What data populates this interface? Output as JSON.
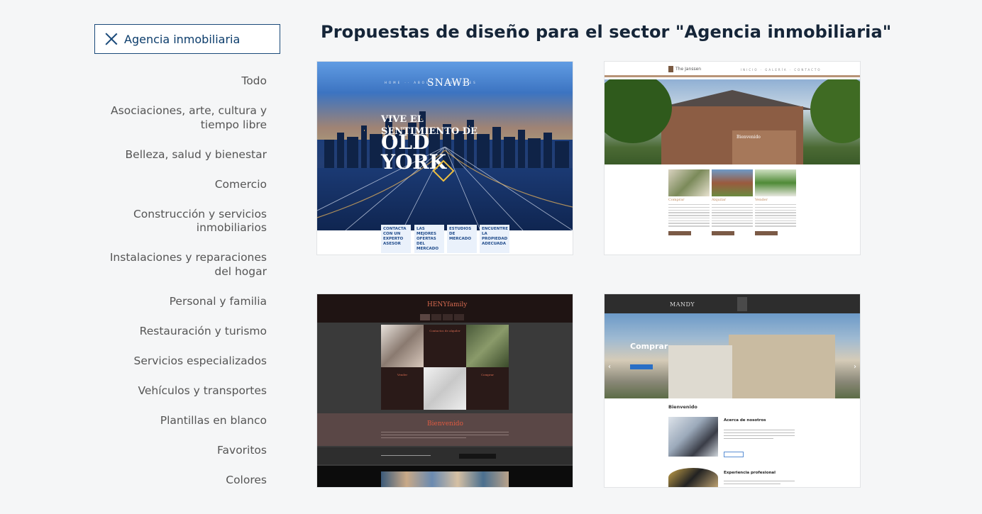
{
  "filter": {
    "active_label": "Agencia inmobiliaria"
  },
  "heading": "Propuestas de diseño para el sector \"Agencia inmobiliaria\"",
  "categories": [
    "Todo",
    "Asociaciones, arte, cultura y tiempo libre",
    "Belleza, salud y bienestar",
    "Comercio",
    "Construcción y servicios inmobiliarios",
    "Instalaciones y reparaciones del hogar",
    "Personal y familia",
    "Restauración y turismo",
    "Servicios especializados",
    "Vehículos y transportes",
    "Plantillas en blanco",
    "Favoritos",
    "Colores"
  ],
  "templates": [
    {
      "logo": "SNAWB",
      "hero_line1": "VIVE EL",
      "hero_line2": "SENTIMIENTO DE",
      "hero_big1": "OLD",
      "hero_big2": "YORK",
      "boxes": [
        "CONTACTA CON UN EXPERTO ASESOR",
        "LAS MEJORES OFERTAS DEL MERCADO",
        "ESTUDIOS DE MERCADO",
        "ENCUENTRE LA PROPIEDAD ADECUADA"
      ]
    },
    {
      "logo": "The Janssen",
      "overlay_title": "Bienvenido",
      "columns": [
        "Comprar",
        "Alquilar",
        "Vender"
      ]
    },
    {
      "logo": "HENYfamily",
      "cells": [
        "Contactos de alquiler",
        "Vender",
        "Comprar"
      ],
      "band_title": "Bienvenido"
    },
    {
      "logo": "MANDY",
      "hero_title": "Comprar",
      "welcome": "Bienvenido",
      "sub1": "Acerca de nosotros",
      "sub2": "Experiencia profesional"
    }
  ]
}
